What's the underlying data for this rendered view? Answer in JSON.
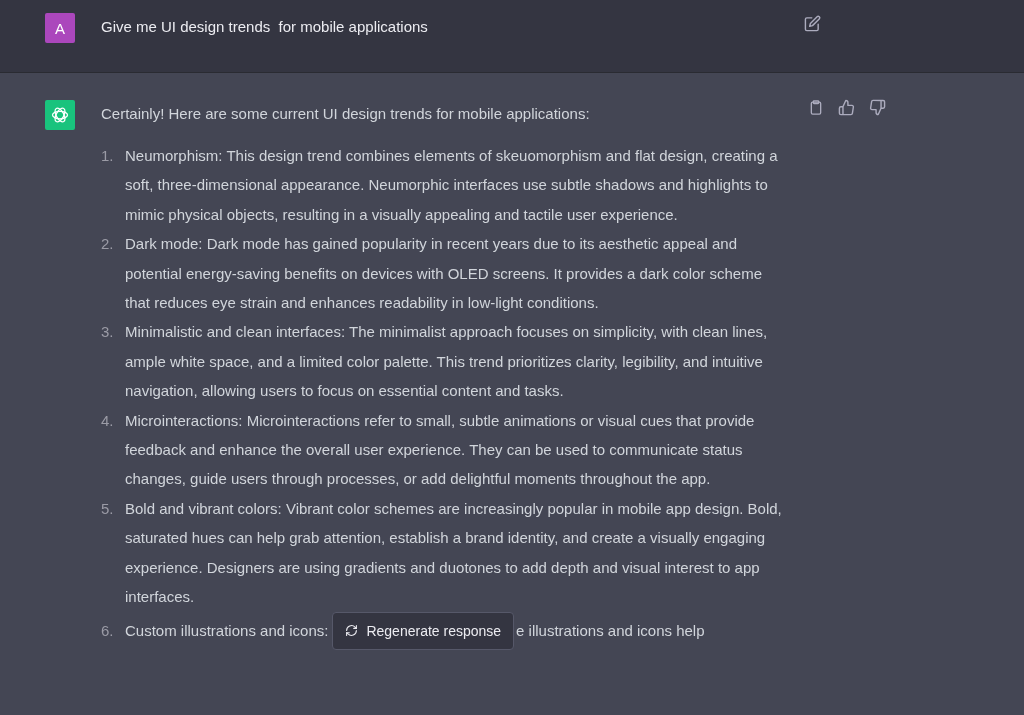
{
  "user_message": {
    "avatar": "A",
    "text": "Give me UI design trends  for mobile applications"
  },
  "response": {
    "intro": "Certainly! Here are some current UI design trends for mobile applications:",
    "items": [
      {
        "number": "1.",
        "text": "Neumorphism: This design trend combines elements of skeuomorphism and flat design, creating a soft, three-dimensional appearance. Neumorphic interfaces use subtle shadows and highlights to mimic physical objects, resulting in a visually appealing and tactile user experience."
      },
      {
        "number": "2.",
        "text": "Dark mode: Dark mode has gained popularity in recent years due to its aesthetic appeal and potential energy-saving benefits on devices with OLED screens. It provides a dark color scheme that reduces eye strain and enhances readability in low-light conditions."
      },
      {
        "number": "3.",
        "text": "Minimalistic and clean interfaces: The minimalist approach focuses on simplicity, with clean lines, ample white space, and a limited color palette. This trend prioritizes clarity, legibility, and intuitive navigation, allowing users to focus on essential content and tasks."
      },
      {
        "number": "4.",
        "text": "Microinteractions: Microinteractions refer to small, subtle animations or visual cues that provide feedback and enhance the overall user experience. They can be used to communicate status changes, guide users through processes, or add delightful moments throughout the app."
      },
      {
        "number": "5.",
        "text": "Bold and vibrant colors: Vibrant color schemes are increasingly popular in mobile app design. Bold, saturated hues can help grab attention, establish a brand identity, and create a visually engaging experience. Designers are using gradients and duotones to add depth and visual interest to app interfaces."
      }
    ],
    "partial_item": {
      "number": "6.",
      "text_before": "Custom illustrations and icons:",
      "text_after": "e illustrations and icons help"
    }
  },
  "regenerate_button": "Regenerate response"
}
